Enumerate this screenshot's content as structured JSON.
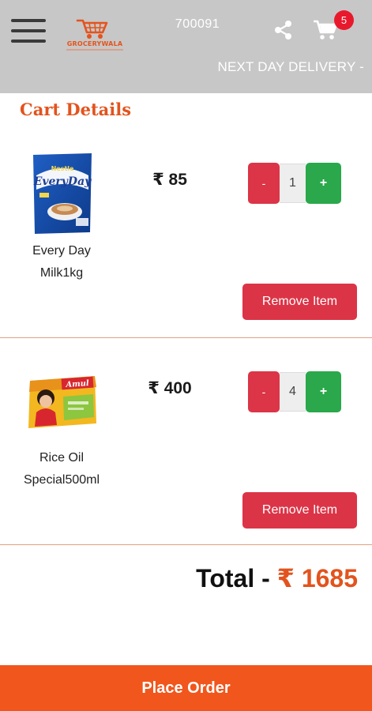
{
  "header": {
    "logo_name": "GROCERYWALA",
    "pincode": "700091",
    "cart_count": "5",
    "delivery_text": "NEXT DAY DELIVERY -"
  },
  "page_title": "Cart Details",
  "items": [
    {
      "name_line1": "Every Day",
      "name_line2": "Milk1kg",
      "price": "₹ 85",
      "quantity": "1",
      "minus_label": "-",
      "plus_label": "+",
      "remove_label": "Remove Item",
      "image_brand": "EveryDay"
    },
    {
      "name_line1": "Rice Oil",
      "name_line2": "Special500ml",
      "price": "₹ 400",
      "quantity": "4",
      "minus_label": "-",
      "plus_label": "+",
      "remove_label": "Remove Item",
      "image_brand": "Amul"
    }
  ],
  "total": {
    "label": "Total - ",
    "amount": "₹ 1685"
  },
  "place_order_label": "Place Order",
  "colors": {
    "accent": "#f1561c",
    "header_bg": "#c7c7c7",
    "danger": "#dc3447",
    "success": "#2aa84b",
    "badge": "#e8192c"
  }
}
